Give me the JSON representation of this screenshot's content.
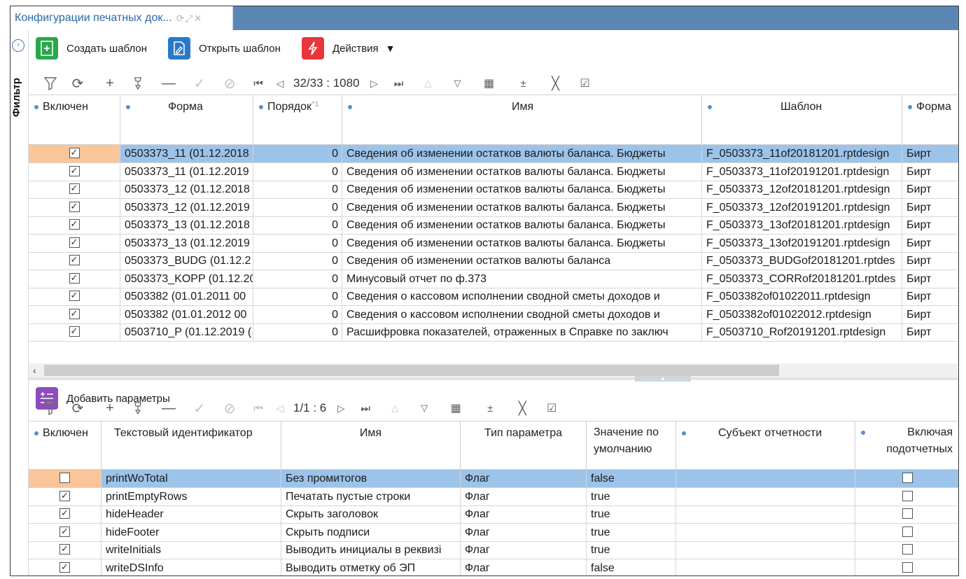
{
  "tab": {
    "title": "Конфигурации печатных док...",
    "icons": "⟳⤢✕"
  },
  "filter_label": "Фильтр",
  "actions": {
    "create": "Создать шаблон",
    "open": "Открыть шаблон",
    "actions": "Действия",
    "add_params": "Добавить параметры"
  },
  "toolbar1": {
    "page_info": "32/33 : 1080"
  },
  "toolbar2": {
    "page_info": "1/1 : 6"
  },
  "grid1": {
    "columns": [
      "Включен",
      "Форма",
      "Порядок",
      "Имя",
      "Шаблон",
      "Форма"
    ],
    "rows": [
      {
        "enabled": true,
        "form": "0503373_11 (01.12.2018",
        "order": "0",
        "name": "Сведения об изменении остатков валюты баланса. Бюджеты",
        "template": "F_0503373_11of20181201.rptdesign",
        "format": "Бирт"
      },
      {
        "enabled": true,
        "form": "0503373_11 (01.12.2019",
        "order": "0",
        "name": "Сведения об изменении остатков валюты баланса. Бюджеты",
        "template": "F_0503373_11of20191201.rptdesign",
        "format": "Бирт"
      },
      {
        "enabled": true,
        "form": "0503373_12 (01.12.2018",
        "order": "0",
        "name": "Сведения об изменении остатков валюты баланса. Бюджеты",
        "template": "F_0503373_12of20181201.rptdesign",
        "format": "Бирт"
      },
      {
        "enabled": true,
        "form": "0503373_12 (01.12.2019",
        "order": "0",
        "name": "Сведения об изменении остатков валюты баланса. Бюджеты",
        "template": "F_0503373_12of20191201.rptdesign",
        "format": "Бирт"
      },
      {
        "enabled": true,
        "form": "0503373_13 (01.12.2018",
        "order": "0",
        "name": "Сведения об изменении остатков валюты баланса. Бюджеты",
        "template": "F_0503373_13of20181201.rptdesign",
        "format": "Бирт"
      },
      {
        "enabled": true,
        "form": "0503373_13 (01.12.2019",
        "order": "0",
        "name": "Сведения об изменении остатков валюты баланса. Бюджеты",
        "template": "F_0503373_13of20191201.rptdesign",
        "format": "Бирт"
      },
      {
        "enabled": true,
        "form": "0503373_BUDG (01.12.2",
        "order": "0",
        "name": "Сведения об изменении остатков валюты баланса",
        "template": "F_0503373_BUDGof20181201.rptdes",
        "format": "Бирт"
      },
      {
        "enabled": true,
        "form": "0503373_KOPP (01.12.20",
        "order": "0",
        "name": "Минусовый отчет по ф.373",
        "template": "F_0503373_CORRof20181201.rptdes",
        "format": "Бирт"
      },
      {
        "enabled": true,
        "form": "0503382 (01.01.2011 00",
        "order": "0",
        "name": "Сведения о кассовом исполнении сводной сметы доходов и",
        "template": "F_0503382of01022011.rptdesign",
        "format": "Бирт"
      },
      {
        "enabled": true,
        "form": "0503382 (01.01.2012 00",
        "order": "0",
        "name": "Сведения о кассовом исполнении сводной сметы доходов и",
        "template": "F_0503382of01022012.rptdesign",
        "format": "Бирт"
      },
      {
        "enabled": true,
        "form": "0503710_P (01.12.2019 (",
        "order": "0",
        "name": "Расшифровка показателей, отраженных в Справке по заключ",
        "template": "F_0503710_Rof20191201.rptdesign",
        "format": "Бирт"
      }
    ]
  },
  "grid2": {
    "columns": [
      "Включен",
      "Текстовый идентификатор",
      "Имя",
      "Тип параметра",
      "Значение по умолчанию",
      "Субъект отчетности",
      "Включая подотчетных"
    ],
    "rows": [
      {
        "enabled": false,
        "id": "printWoTotal",
        "name": "Без промитогов",
        "type": "Флаг",
        "default": "false",
        "subject": "",
        "incl": false
      },
      {
        "enabled": true,
        "id": "printEmptyRows",
        "name": "Печатать пустые строки",
        "type": "Флаг",
        "default": "true",
        "subject": "",
        "incl": false
      },
      {
        "enabled": true,
        "id": "hideHeader",
        "name": "Скрыть заголовок",
        "type": "Флаг",
        "default": "true",
        "subject": "",
        "incl": false
      },
      {
        "enabled": true,
        "id": "hideFooter",
        "name": "Скрыть подписи",
        "type": "Флаг",
        "default": "true",
        "subject": "",
        "incl": false
      },
      {
        "enabled": true,
        "id": "writeInitials",
        "name": "Выводить инициалы в реквизі",
        "type": "Флаг",
        "default": "true",
        "subject": "",
        "incl": false
      },
      {
        "enabled": true,
        "id": "writeDSInfo",
        "name": "Выводить отметку об ЭП",
        "type": "Флаг",
        "default": "false",
        "subject": "",
        "incl": false
      }
    ]
  }
}
